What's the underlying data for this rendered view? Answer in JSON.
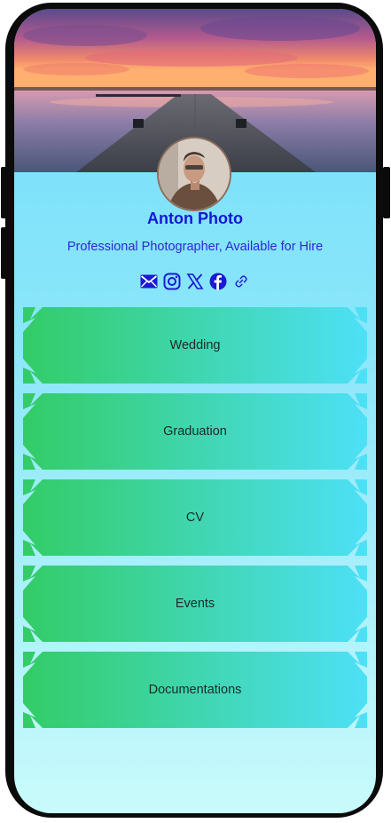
{
  "profile": {
    "name": "Anton Photo",
    "bio": "Professional Photographer, Available for Hire"
  },
  "socials": [
    {
      "icon": "email-icon"
    },
    {
      "icon": "instagram-icon"
    },
    {
      "icon": "x-twitter-icon"
    },
    {
      "icon": "facebook-icon"
    },
    {
      "icon": "link-icon"
    }
  ],
  "links": [
    {
      "label": "Wedding"
    },
    {
      "label": "Graduation"
    },
    {
      "label": "CV"
    },
    {
      "label": "Events"
    },
    {
      "label": "Documentations"
    }
  ],
  "colors": {
    "name_text": "#1515d8",
    "icon": "#1a1ad4",
    "button_gradient_start": "#33cc66",
    "button_gradient_end": "#4de0f7",
    "background_top": "#74def9",
    "background_bottom": "#c9fbfb"
  }
}
